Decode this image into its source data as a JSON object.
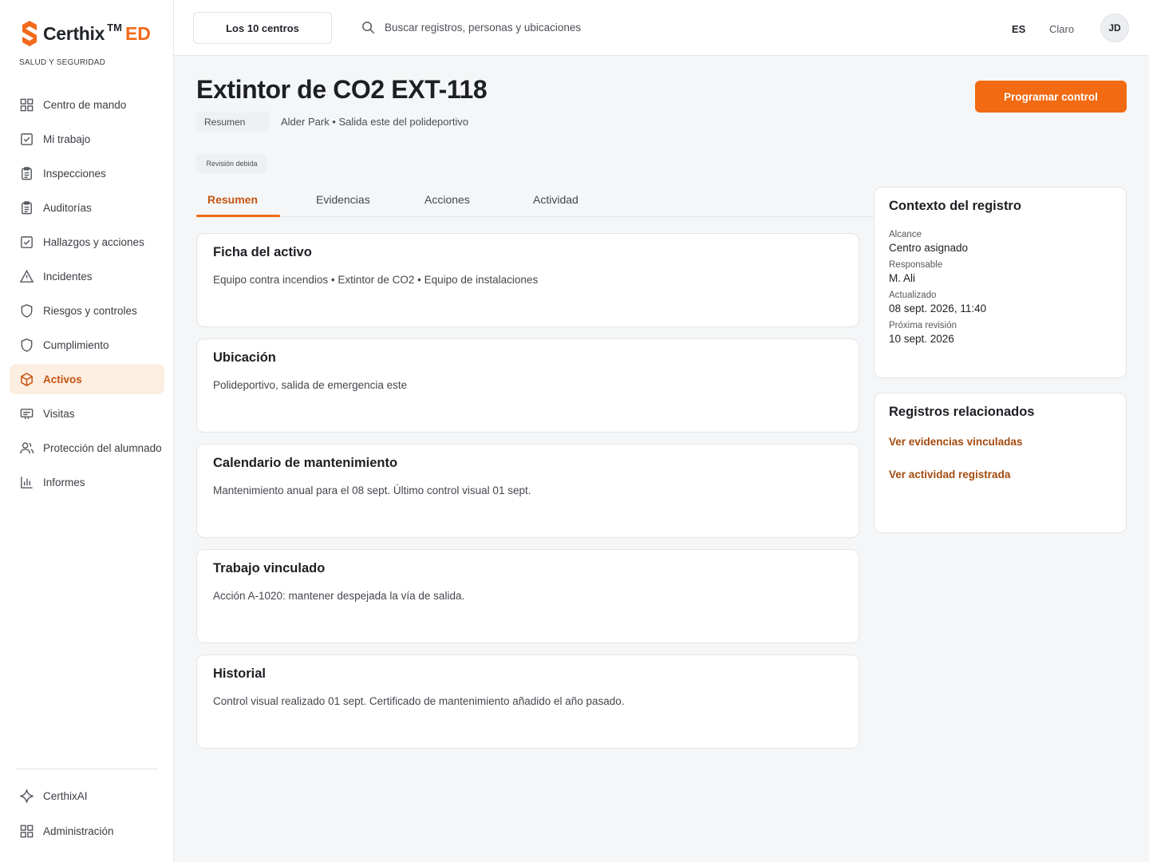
{
  "brand": {
    "name": "Certhix",
    "tm": "TM",
    "suffix": "ED",
    "subtitle": "SALUD Y SEGURIDAD",
    "accent": "#f26a1b"
  },
  "sidebar": {
    "items": [
      {
        "label": "Centro de mando",
        "icon": "grid-icon"
      },
      {
        "label": "Mi trabajo",
        "icon": "checkbox-icon"
      },
      {
        "label": "Inspecciones",
        "icon": "clipboard-icon"
      },
      {
        "label": "Auditorías",
        "icon": "clipboard-icon"
      },
      {
        "label": "Hallazgos y acciones",
        "icon": "checkbox-icon"
      },
      {
        "label": "Incidentes",
        "icon": "warning-icon"
      },
      {
        "label": "Riesgos y controles",
        "icon": "shield-icon"
      },
      {
        "label": "Cumplimiento",
        "icon": "shield-icon"
      },
      {
        "label": "Activos",
        "icon": "box-icon",
        "active": true
      },
      {
        "label": "Visitas",
        "icon": "id-card-icon"
      },
      {
        "label": "Protección del alumnado",
        "icon": "users-icon"
      },
      {
        "label": "Informes",
        "icon": "bar-chart-icon"
      }
    ],
    "bottom": [
      {
        "label": "CerthixAI",
        "icon": "sparkle-icon"
      },
      {
        "label": "Administración",
        "icon": "grid-icon"
      }
    ]
  },
  "topbar": {
    "scope": "Los 10 centros",
    "search_placeholder": "Buscar registros, personas y ubicaciones",
    "language": "ES",
    "theme": "Claro",
    "avatar_initials": "JD"
  },
  "header": {
    "title": "Extintor de CO2 EXT-118",
    "summary_chip": "Resumen",
    "location": "Alder Park • Salida este del polideportivo",
    "status_badge": "Revisión debida",
    "primary_action": "Programar control"
  },
  "tabs": [
    "Resumen",
    "Evidencias",
    "Acciones",
    "Actividad"
  ],
  "cards": [
    {
      "title": "Ficha del activo",
      "body": "Equipo contra incendios • Extintor de CO2 • Equipo de instalaciones"
    },
    {
      "title": "Ubicación",
      "body": "Polideportivo, salida de emergencia este"
    },
    {
      "title": "Calendario de mantenimiento",
      "body": "Mantenimiento anual para el 08 sept. Último control visual 01 sept."
    },
    {
      "title": "Trabajo vinculado",
      "body": "Acción A-1020: mantener despejada la vía de salida."
    },
    {
      "title": "Historial",
      "body": "Control visual realizado 01 sept. Certificado de mantenimiento añadido el año pasado."
    }
  ],
  "context": {
    "title": "Contexto del registro",
    "fields": [
      {
        "label": "Alcance",
        "value": "Centro asignado"
      },
      {
        "label": "Responsable",
        "value": "M. Ali"
      },
      {
        "label": "Actualizado",
        "value": "08 sept. 2026, 11:40"
      },
      {
        "label": "Próxima revisión",
        "value": "10 sept. 2026"
      }
    ]
  },
  "related": {
    "title": "Registros relacionados",
    "links": [
      "Ver evidencias vinculadas",
      "Ver actividad registrada"
    ]
  }
}
